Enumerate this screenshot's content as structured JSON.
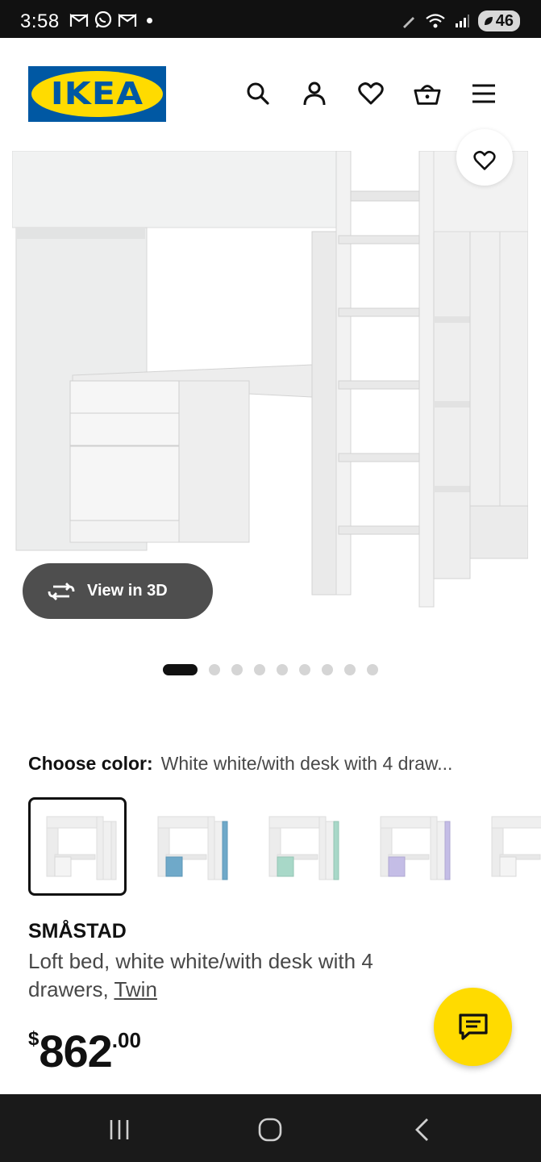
{
  "status_bar": {
    "time": "3:58",
    "battery": "46",
    "notification_icons": [
      "gmail-icon",
      "whatsapp-icon",
      "gmail-icon"
    ]
  },
  "header": {
    "logo_text": "IKEA",
    "icons": [
      "search-icon",
      "account-icon",
      "heart-icon",
      "basket-icon",
      "menu-icon"
    ]
  },
  "gallery": {
    "view_3d_label": "View in 3D",
    "image_count": 9,
    "active_index": 0
  },
  "color_chooser": {
    "label": "Choose color:",
    "selected_value": "White white/with desk with 4 draw...",
    "swatches": [
      {
        "accent": "#ffffff",
        "selected": true
      },
      {
        "accent": "#6fa9c9",
        "selected": false
      },
      {
        "accent": "#a8d8c8",
        "selected": false
      },
      {
        "accent": "#c4bde6",
        "selected": false
      },
      {
        "accent": "#ffffff",
        "selected": false
      }
    ]
  },
  "product": {
    "name": "SMÅSTAD",
    "description": "Loft bed, white white/with desk with 4 drawers, ",
    "size_link": "Twin",
    "price_currency": "$",
    "price_main": "862",
    "price_decimal": ".00"
  },
  "colors": {
    "brand_blue": "#0058a3",
    "brand_yellow": "#ffdb00"
  }
}
